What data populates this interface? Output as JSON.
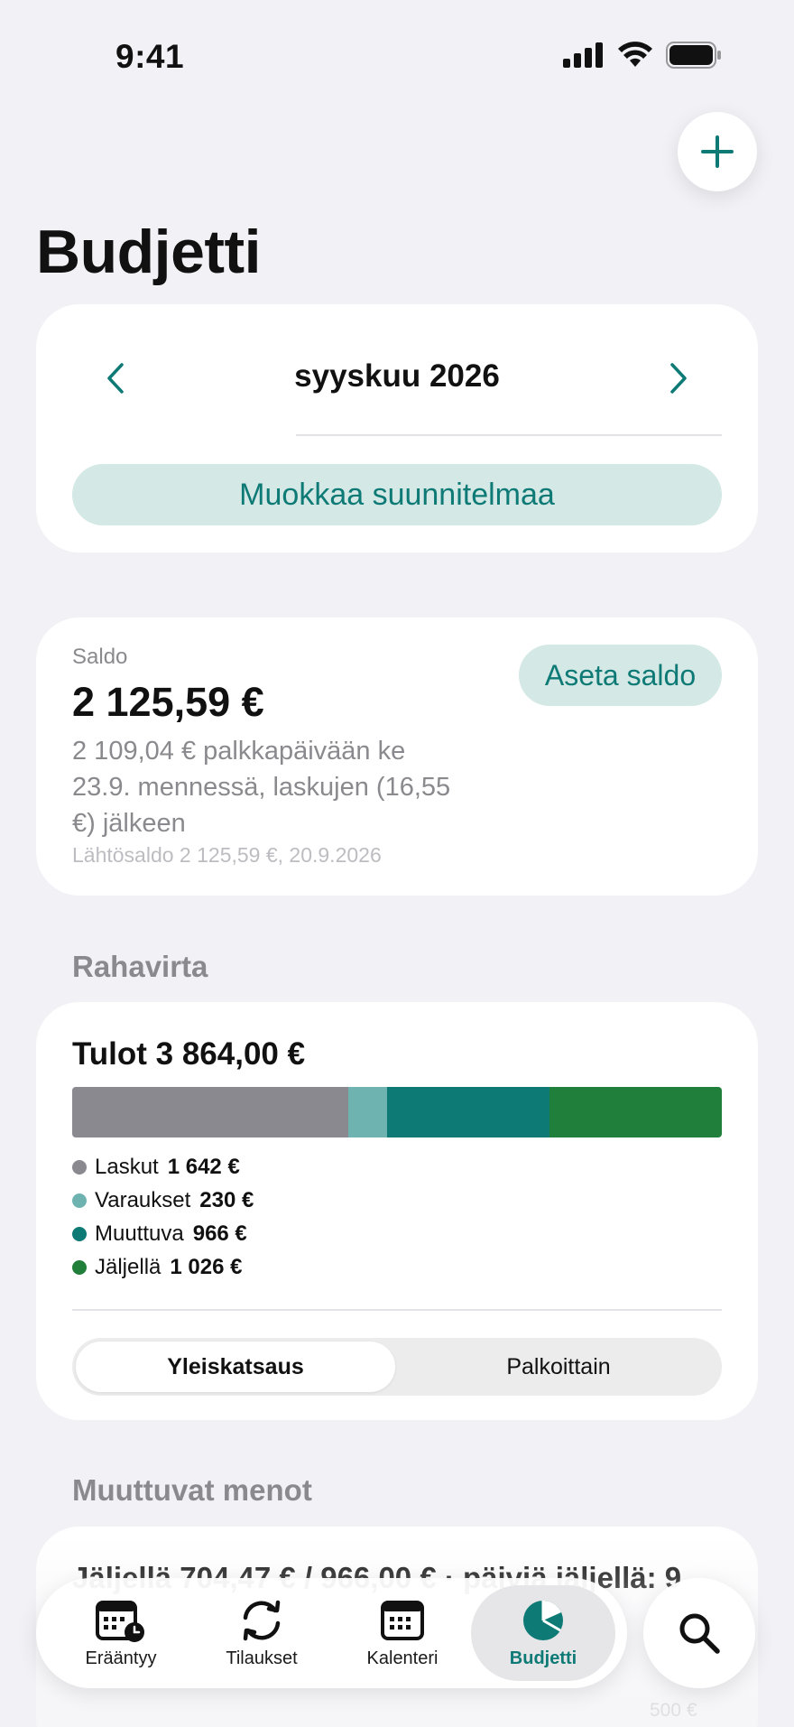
{
  "status_bar": {
    "time": "9:41"
  },
  "header": {
    "title": "Budjetti"
  },
  "month_card": {
    "month_label": "syyskuu 2026",
    "edit_plan_label": "Muokkaa suunnitelmaa"
  },
  "balance": {
    "label": "Saldo",
    "amount": "2 125,59 €",
    "description": "2 109,04 € palkkapäivään ke 23.9. mennessä, laskujen (16,55 €) jälkeen",
    "start_note": "Lähtösaldo 2 125,59 €, 20.9.2026",
    "set_button_label": "Aseta saldo"
  },
  "cashflow": {
    "section_title": "Rahavirta",
    "income_title": "Tulot 3 864,00 €",
    "legend": [
      {
        "label": "Laskut",
        "value": "1 642 €",
        "color": "#8a898f"
      },
      {
        "label": "Varaukset",
        "value": "230 €",
        "color": "#6fb3b0"
      },
      {
        "label": "Muuttuva",
        "value": "966 €",
        "color": "#0e7a76"
      },
      {
        "label": "Jäljellä",
        "value": "1 026 €",
        "color": "#207f3a"
      }
    ],
    "segments": [
      "Yleiskatsaus",
      "Palkoittain"
    ]
  },
  "chart_data": {
    "type": "bar",
    "categories": [
      "Laskut",
      "Varaukset",
      "Muuttuva",
      "Jäljellä"
    ],
    "values": [
      1642,
      230,
      966,
      1026
    ],
    "title": "Tulot 3 864,00 €",
    "xlabel": "",
    "ylabel": ""
  },
  "variable": {
    "section_title": "Muuttuvat menot",
    "summary": "Jäljellä 704,47 € / 966,00 € · päiviä jäljellä: 9",
    "axis_label": "500 €"
  },
  "tab_bar": {
    "tabs": [
      {
        "label": "Erääntyy",
        "icon": "calendar-clock-icon"
      },
      {
        "label": "Tilaukset",
        "icon": "refresh-icon"
      },
      {
        "label": "Kalenteri",
        "icon": "calendar-icon"
      },
      {
        "label": "Budjetti",
        "icon": "pie-chart-icon"
      }
    ],
    "search_icon": "search-icon"
  },
  "colors": {
    "accent": "#0e7a76",
    "accent_soft": "#d4e8e6",
    "background": "#f2f2f6"
  }
}
